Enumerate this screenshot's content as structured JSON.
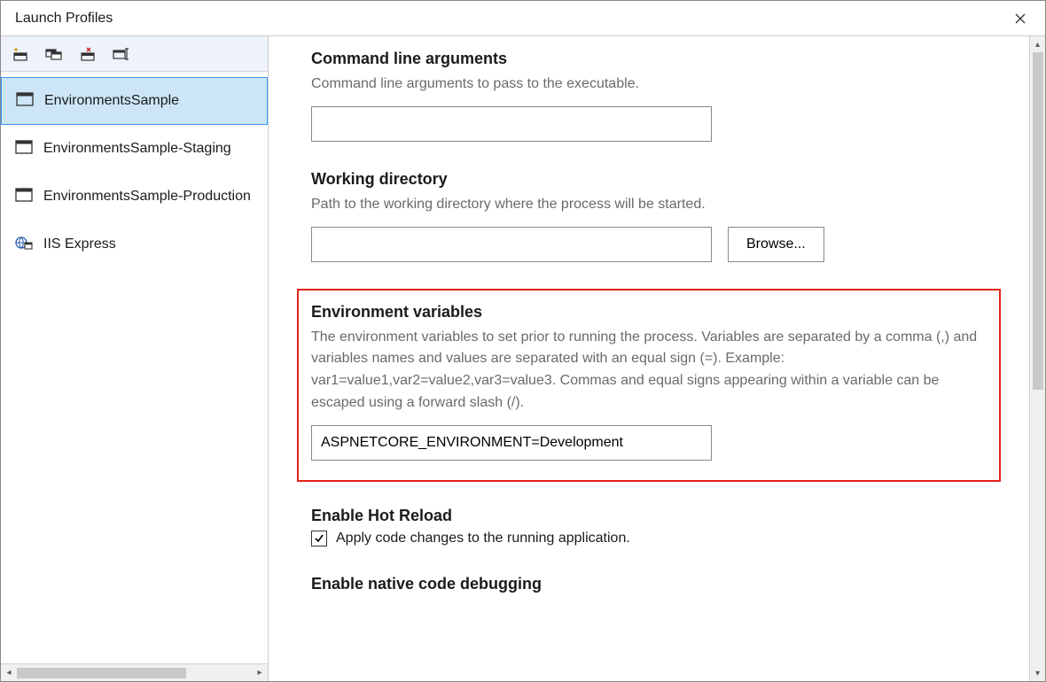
{
  "window": {
    "title": "Launch Profiles"
  },
  "profiles": [
    {
      "label": "EnvironmentsSample",
      "icon": "window",
      "selected": true
    },
    {
      "label": "EnvironmentsSample-Staging",
      "icon": "window",
      "selected": false
    },
    {
      "label": "EnvironmentsSample-Production",
      "icon": "window",
      "selected": false
    },
    {
      "label": "IIS Express",
      "icon": "globe",
      "selected": false
    }
  ],
  "form": {
    "cmd_args": {
      "title": "Command line arguments",
      "desc": "Command line arguments to pass to the executable.",
      "value": ""
    },
    "working_dir": {
      "title": "Working directory",
      "desc": "Path to the working directory where the process will be started.",
      "value": "",
      "browse_label": "Browse..."
    },
    "env_vars": {
      "title": "Environment variables",
      "desc": "The environment variables to set prior to running the process. Variables are separated by a comma (,) and variables names and values are separated with an equal sign (=). Example: var1=value1,var2=value2,var3=value3. Commas and equal signs appearing within a variable can be escaped using a forward slash (/).",
      "value": "ASPNETCORE_ENVIRONMENT=Development"
    },
    "hot_reload": {
      "title": "Enable Hot Reload",
      "checkbox_label": "Apply code changes to the running application.",
      "checked": true
    },
    "native_debug": {
      "title": "Enable native code debugging"
    }
  }
}
